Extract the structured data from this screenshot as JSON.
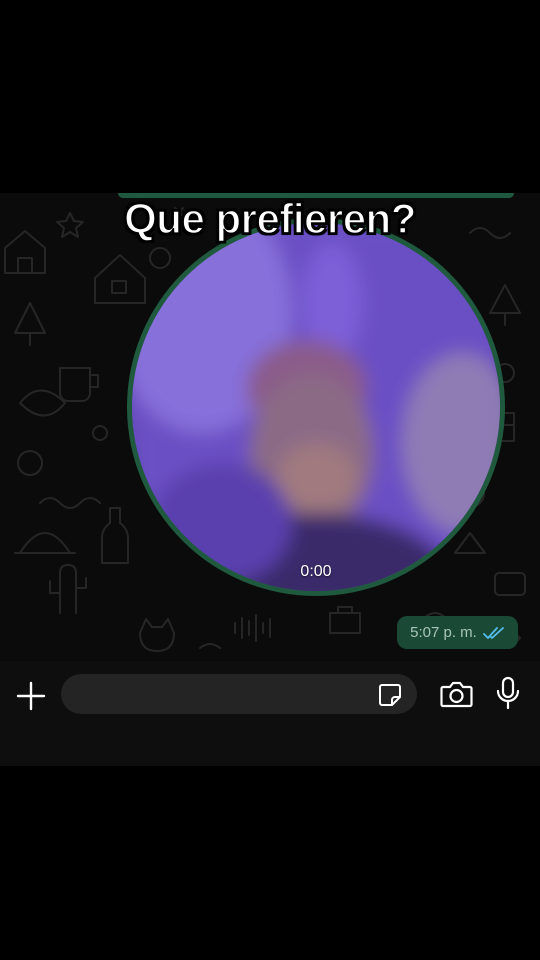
{
  "caption": "Que prefieren?",
  "video_message": {
    "duration": "0:00",
    "time": "5:07 p. m.",
    "status_icon": "double-check-icon",
    "status_color": "#53bdeb"
  },
  "composer": {
    "text_value": "",
    "attach_icon": "plus-icon",
    "sticker_icon": "sticker-icon",
    "camera_icon": "camera-icon",
    "mic_icon": "microphone-icon"
  },
  "colors": {
    "bubble_green": "#1f5a3e",
    "chat_background": "#0b0b0b",
    "composer_background": "#0e0e0e"
  }
}
